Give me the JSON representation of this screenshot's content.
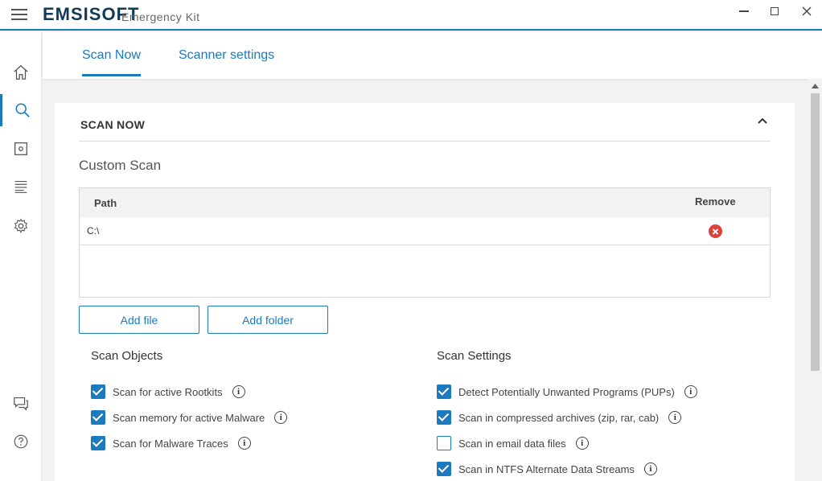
{
  "titlebar": {
    "brand": "EMSISOFT",
    "product": "Emergency Kit",
    "menu_icon": "hamburger-icon",
    "minimize_icon": "minimize-icon",
    "maximize_icon": "maximize-icon",
    "close_icon": "close-icon"
  },
  "sidebar": {
    "items": [
      {
        "name": "home",
        "icon": "home-icon"
      },
      {
        "name": "scan",
        "icon": "search-icon",
        "active": true
      },
      {
        "name": "quarantine",
        "icon": "quarantine-icon"
      },
      {
        "name": "logs",
        "icon": "logs-icon"
      },
      {
        "name": "settings",
        "icon": "gear-icon"
      },
      {
        "name": "feedback",
        "icon": "chat-icon"
      },
      {
        "name": "help",
        "icon": "help-icon"
      }
    ]
  },
  "tabs": {
    "scan_now": "Scan Now",
    "scanner_settings": "Scanner settings"
  },
  "panel": {
    "title": "SCAN NOW",
    "subtitle": "Custom Scan",
    "table": {
      "col_path": "Path",
      "col_remove": "Remove",
      "rows": [
        {
          "path": "C:\\"
        }
      ]
    },
    "buttons": {
      "add_file": "Add file",
      "add_folder": "Add folder"
    }
  },
  "scan_objects": {
    "title": "Scan Objects",
    "items": [
      {
        "label": "Scan for active Rootkits",
        "checked": true
      },
      {
        "label": "Scan memory for active Malware",
        "checked": true
      },
      {
        "label": "Scan for Malware Traces",
        "checked": true
      }
    ]
  },
  "scan_settings": {
    "title": "Scan Settings",
    "items": [
      {
        "label": "Detect Potentially Unwanted Programs (PUPs)",
        "checked": true
      },
      {
        "label": "Scan in compressed archives (zip, rar, cab)",
        "checked": true
      },
      {
        "label": "Scan in email data files",
        "checked": false
      },
      {
        "label": "Scan in NTFS Alternate Data Streams",
        "checked": true
      }
    ]
  },
  "info_glyph": "i",
  "colors": {
    "accent": "#1a7bbf",
    "remove": "#e0403a",
    "brand_text": "#123a56"
  }
}
